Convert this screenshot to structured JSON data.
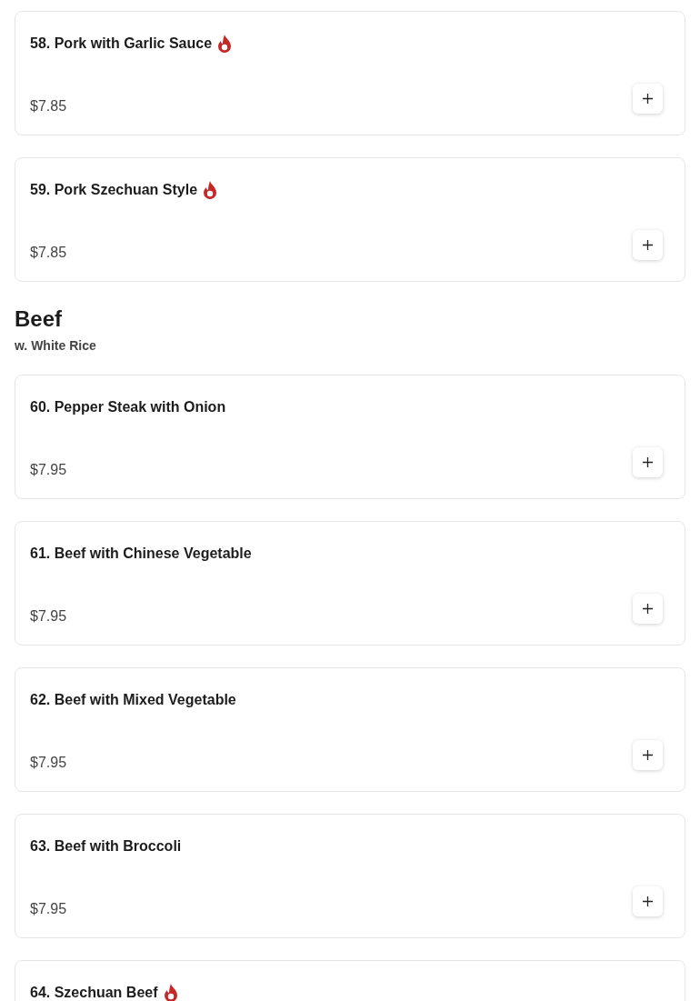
{
  "sections": [
    {
      "items": [
        {
          "name": "58. Pork with Garlic Sauce",
          "spicy": true,
          "price": "$7.85"
        },
        {
          "name": "59. Pork Szechuan Style",
          "spicy": true,
          "price": "$7.85"
        }
      ]
    },
    {
      "title": "Beef",
      "subtitle": "w. White Rice",
      "items": [
        {
          "name": "60. Pepper Steak with Onion",
          "spicy": false,
          "price": "$7.95"
        },
        {
          "name": "61. Beef with Chinese Vegetable",
          "spicy": false,
          "price": "$7.95"
        },
        {
          "name": "62. Beef with Mixed Vegetable",
          "spicy": false,
          "price": "$7.95"
        },
        {
          "name": "63. Beef with Broccoli",
          "spicy": false,
          "price": "$7.95"
        },
        {
          "name": "64. Szechuan Beef",
          "spicy": true
        }
      ]
    }
  ]
}
